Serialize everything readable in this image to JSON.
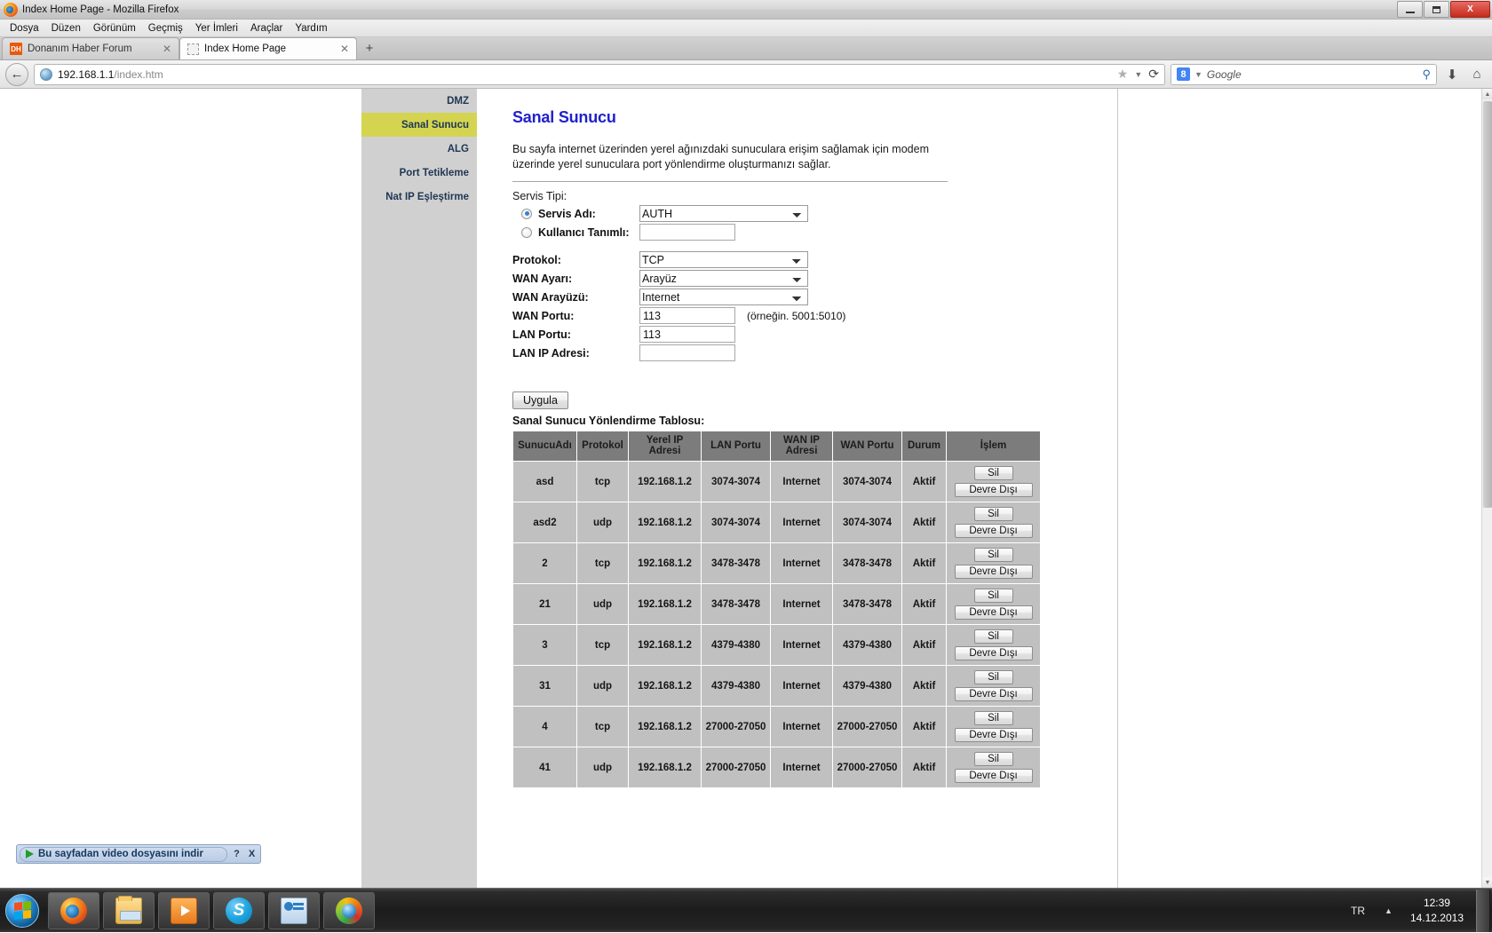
{
  "window": {
    "title": "Index Home Page - Mozilla Firefox",
    "minimize_label": "Minimize",
    "maximize_label": "Maximize",
    "close_label": "X"
  },
  "menubar": [
    {
      "label": "Dosya"
    },
    {
      "label": "Düzen"
    },
    {
      "label": "Görünüm"
    },
    {
      "label": "Geçmiş"
    },
    {
      "label": "Yer İmleri"
    },
    {
      "label": "Araçlar"
    },
    {
      "label": "Yardım"
    }
  ],
  "tabs": [
    {
      "label": "Donanım Haber Forum",
      "favicon": "DH",
      "active": false,
      "close": "✕"
    },
    {
      "label": "Index Home Page",
      "favicon": "blank",
      "active": true,
      "close": "✕"
    }
  ],
  "newtab_label": "+",
  "navbar": {
    "back_icon": "back-arrow-icon",
    "url_host": "192.168.1.1",
    "url_path": "/index.htm",
    "star_icon": "★",
    "caret_icon": "▼",
    "reload_icon": "⟳",
    "search_engine": "8",
    "search_placeholder": "Google",
    "search_icon": "⚲",
    "download_icon": "⬇",
    "home_icon": "⌂"
  },
  "sidebar": {
    "items": [
      {
        "label": "DMZ",
        "active": false
      },
      {
        "label": "Sanal Sunucu",
        "active": true
      },
      {
        "label": "ALG",
        "active": false
      },
      {
        "label": "Port Tetikleme",
        "active": false
      },
      {
        "label": "Nat IP Eşleştirme",
        "active": false
      }
    ]
  },
  "page": {
    "title": "Sanal Sunucu",
    "description": "Bu sayfa internet üzerinden yerel ağınızdaki sunuculara erişim sağlamak için modem üzerinde yerel sunuculara port yönlendirme oluşturmanızı sağlar.",
    "service_type_label": "Servis Tipi:",
    "form": {
      "service_name_label": "Servis Adı:",
      "service_name_value": "AUTH",
      "custom_label": "Kullanıcı Tanımlı:",
      "custom_value": "",
      "protocol_label": "Protokol:",
      "protocol_value": "TCP",
      "wan_setting_label": "WAN Ayarı:",
      "wan_setting_value": "Arayüz",
      "wan_interface_label": "WAN Arayüzü:",
      "wan_interface_value": "Internet",
      "wan_port_label": "WAN Portu:",
      "wan_port_value": "113",
      "wan_port_hint": "(örneğin. 5001:5010)",
      "lan_port_label": "LAN Portu:",
      "lan_port_value": "113",
      "lan_ip_label": "LAN IP Adresi:",
      "lan_ip_value": ""
    },
    "apply_button": "Uygula",
    "table_caption": "Sanal Sunucu Yönlendirme Tablosu:",
    "table": {
      "headers": [
        "SunucuAdı",
        "Protokol",
        "Yerel IP Adresi",
        "LAN Portu",
        "WAN IP Adresi",
        "WAN Portu",
        "Durum",
        "İşlem"
      ],
      "delete_label": "Sil",
      "disable_label": "Devre Dışı",
      "rows": [
        {
          "name": "asd",
          "protocol": "tcp",
          "local_ip": "192.168.1.2",
          "lan_port": "3074-3074",
          "wan_ip": "Internet",
          "wan_port": "3074-3074",
          "status": "Aktif"
        },
        {
          "name": "asd2",
          "protocol": "udp",
          "local_ip": "192.168.1.2",
          "lan_port": "3074-3074",
          "wan_ip": "Internet",
          "wan_port": "3074-3074",
          "status": "Aktif"
        },
        {
          "name": "2",
          "protocol": "tcp",
          "local_ip": "192.168.1.2",
          "lan_port": "3478-3478",
          "wan_ip": "Internet",
          "wan_port": "3478-3478",
          "status": "Aktif"
        },
        {
          "name": "21",
          "protocol": "udp",
          "local_ip": "192.168.1.2",
          "lan_port": "3478-3478",
          "wan_ip": "Internet",
          "wan_port": "3478-3478",
          "status": "Aktif"
        },
        {
          "name": "3",
          "protocol": "tcp",
          "local_ip": "192.168.1.2",
          "lan_port": "4379-4380",
          "wan_ip": "Internet",
          "wan_port": "4379-4380",
          "status": "Aktif"
        },
        {
          "name": "31",
          "protocol": "udp",
          "local_ip": "192.168.1.2",
          "lan_port": "4379-4380",
          "wan_ip": "Internet",
          "wan_port": "4379-4380",
          "status": "Aktif"
        },
        {
          "name": "4",
          "protocol": "tcp",
          "local_ip": "192.168.1.2",
          "lan_port": "27000-27050",
          "wan_ip": "Internet",
          "wan_port": "27000-27050",
          "status": "Aktif"
        },
        {
          "name": "41",
          "protocol": "udp",
          "local_ip": "192.168.1.2",
          "lan_port": "27000-27050",
          "wan_ip": "Internet",
          "wan_port": "27000-27050",
          "status": "Aktif"
        }
      ]
    }
  },
  "download_bar": {
    "label": "Bu sayfadan video dosyasını indir",
    "help_label": "?",
    "close_label": "X"
  },
  "taskbar": {
    "start_label": "Start",
    "buttons": [
      {
        "name": "firefox",
        "label": "Mozilla Firefox"
      },
      {
        "name": "explorer",
        "label": "Windows Gezgini"
      },
      {
        "name": "media",
        "label": "Media Player"
      },
      {
        "name": "skype",
        "label": "Skype",
        "glyph": "S"
      },
      {
        "name": "cpanel",
        "label": "Denetim Masası"
      },
      {
        "name": "idm",
        "label": "Internet Download Manager"
      }
    ],
    "tray_language": "TR",
    "tray_arrow": "▲",
    "clock_time": "12:39",
    "clock_date": "14.12.2013"
  }
}
